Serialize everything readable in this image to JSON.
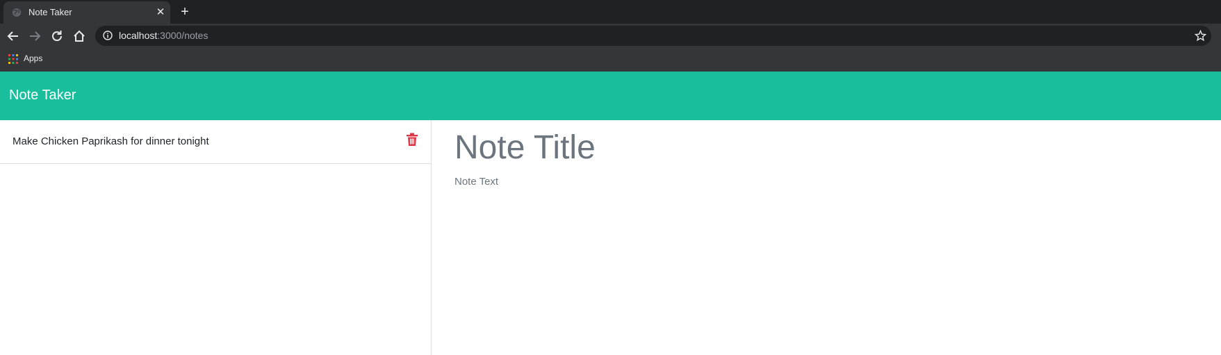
{
  "browser": {
    "tab": {
      "title": "Note Taker",
      "close_glyph": "✕",
      "favicon": "globe-icon"
    },
    "new_tab_glyph": "+",
    "address": {
      "host": "localhost",
      "path": ":3000/notes"
    },
    "bookmarks": {
      "apps_label": "Apps"
    }
  },
  "app": {
    "brand": "Note Taker",
    "notes": [
      {
        "title": "Make Chicken Paprikash for dinner tonight"
      }
    ],
    "editor": {
      "title_placeholder": "Note Title",
      "text_placeholder": "Note Text"
    },
    "colors": {
      "navbar": "#19be9c",
      "delete": "#dc3545",
      "placeholder": "#6c757d"
    }
  }
}
